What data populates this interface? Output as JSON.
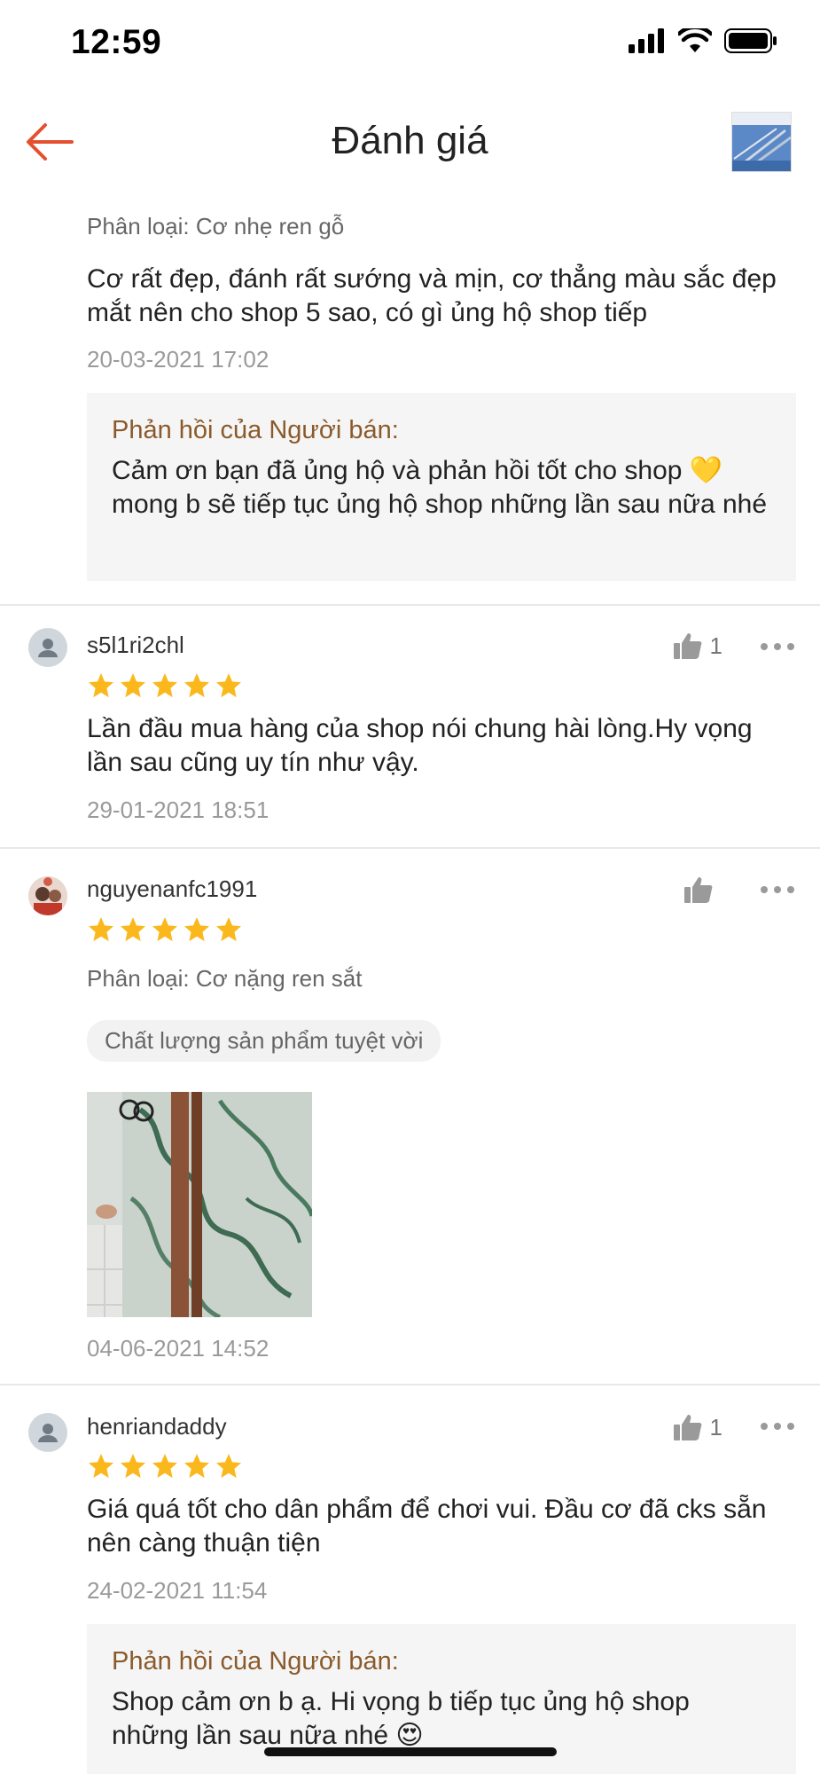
{
  "status": {
    "time": "12:59"
  },
  "nav": {
    "title": "Đánh giá",
    "accent": "#e4502f"
  },
  "reviews": [
    {
      "variant": "Phân loại: Cơ nhẹ ren gỗ",
      "text": "Cơ rất đẹp, đánh rất sướng và mịn, cơ thẳng màu sắc đẹp mắt nên cho  shop 5 sao, có gì ủng hộ shop tiếp",
      "date": "20-03-2021 17:02",
      "seller_title": "Phản hồi của Người bán:",
      "seller_text": "Cảm ơn bạn đã ủng hộ và phản hồi tốt cho shop 💛 mong b sẽ tiếp tục ủng hộ shop những lần sau nữa nhé"
    },
    {
      "user": "s5l1ri2chl",
      "likes": "1",
      "stars": 5,
      "text": "Lần đầu mua hàng của shop nói chung hài lòng.Hy vọng lần sau cũng uy tín như vậy.",
      "date": "29-01-2021 18:51"
    },
    {
      "user": "nguyenanfc1991",
      "likes": "",
      "stars": 5,
      "variant": "Phân loại: Cơ nặng ren sắt",
      "tag": "Chất lượng sản phẩm tuyệt vời",
      "date": "04-06-2021 14:52"
    },
    {
      "user": "henriandaddy",
      "likes": "1",
      "stars": 5,
      "text": "Giá quá tốt cho dân phẩm để chơi vui. Đầu cơ đã cks sẵn nên càng thuận tiện",
      "date": "24-02-2021 11:54",
      "seller_title": "Phản hồi của Người bán:",
      "seller_text": "Shop cảm ơn b ạ. Hi vọng b tiếp tục ủng hộ shop những lần sau nữa nhé 😍"
    }
  ],
  "colors": {
    "star": "#fbb81c",
    "seller_title": "#8b5a2b"
  }
}
